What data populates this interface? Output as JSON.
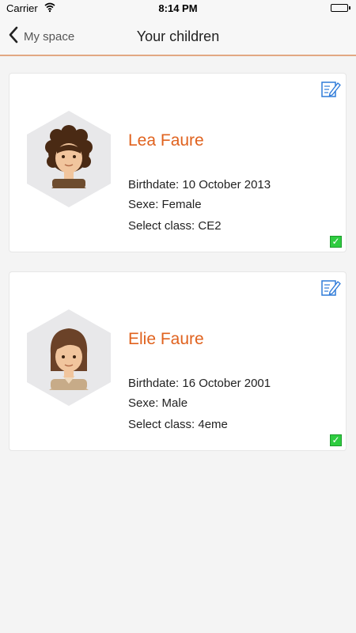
{
  "status_bar": {
    "carrier": "Carrier",
    "time": "8:14 PM"
  },
  "nav": {
    "back_label": "My space",
    "title": "Your children"
  },
  "children": [
    {
      "name": "Lea Faure",
      "birthdate": "Birthdate: 10 October 2013",
      "sexe": "Sexe: Female",
      "class": "Select class: CE2",
      "selected": true,
      "avatar": "avatar-curly-hair-icon"
    },
    {
      "name": "Elie Faure",
      "birthdate": "Birthdate: 16 October 2001",
      "sexe": "Sexe: Male",
      "class": "Select class: 4eme",
      "selected": true,
      "avatar": "avatar-brown-hair-icon"
    }
  ],
  "colors": {
    "accent": "#e0621e",
    "nav_border": "#e2a883",
    "edit_icon": "#2f7bd9",
    "checkbox": "#2ecc40"
  }
}
